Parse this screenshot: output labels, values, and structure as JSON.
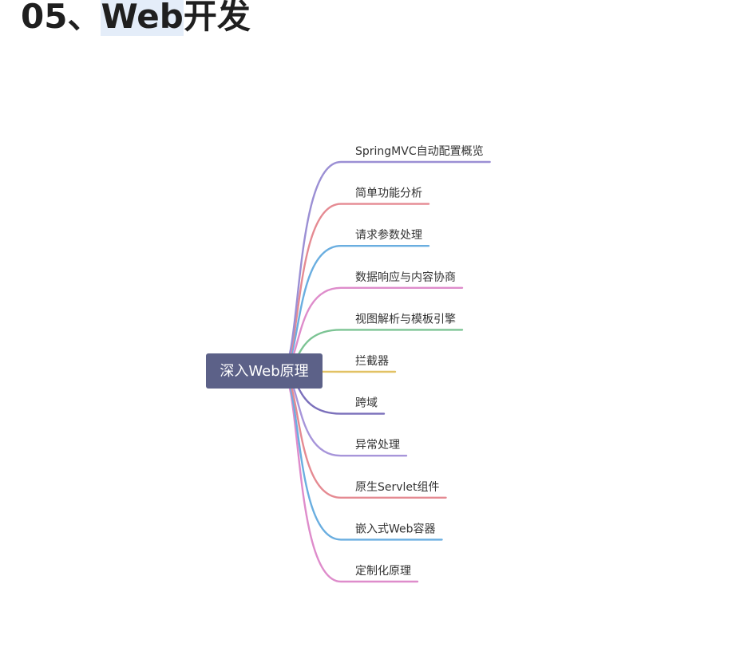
{
  "heading": {
    "prefix": "05、",
    "highlight": "Web",
    "suffix": "开发"
  },
  "mindmap": {
    "root": "深入Web原理",
    "root_color": "#5c6188",
    "branches": [
      {
        "label": "SpringMVC自动配置概览",
        "color": "#9b8fd4"
      },
      {
        "label": "简单功能分析",
        "color": "#e58a92"
      },
      {
        "label": "请求参数处理",
        "color": "#6aaee0"
      },
      {
        "label": "数据响应与内容协商",
        "color": "#de8ccb"
      },
      {
        "label": "视图解析与模板引擎",
        "color": "#7cc494"
      },
      {
        "label": "拦截器",
        "color": "#e2c264"
      },
      {
        "label": "跨域",
        "color": "#7b70bb"
      },
      {
        "label": "异常处理",
        "color": "#a795da"
      },
      {
        "label": "原生Servlet组件",
        "color": "#e58a92"
      },
      {
        "label": "嵌入式Web容器",
        "color": "#6aaee0"
      },
      {
        "label": "定制化原理",
        "color": "#de8ccb"
      }
    ]
  }
}
